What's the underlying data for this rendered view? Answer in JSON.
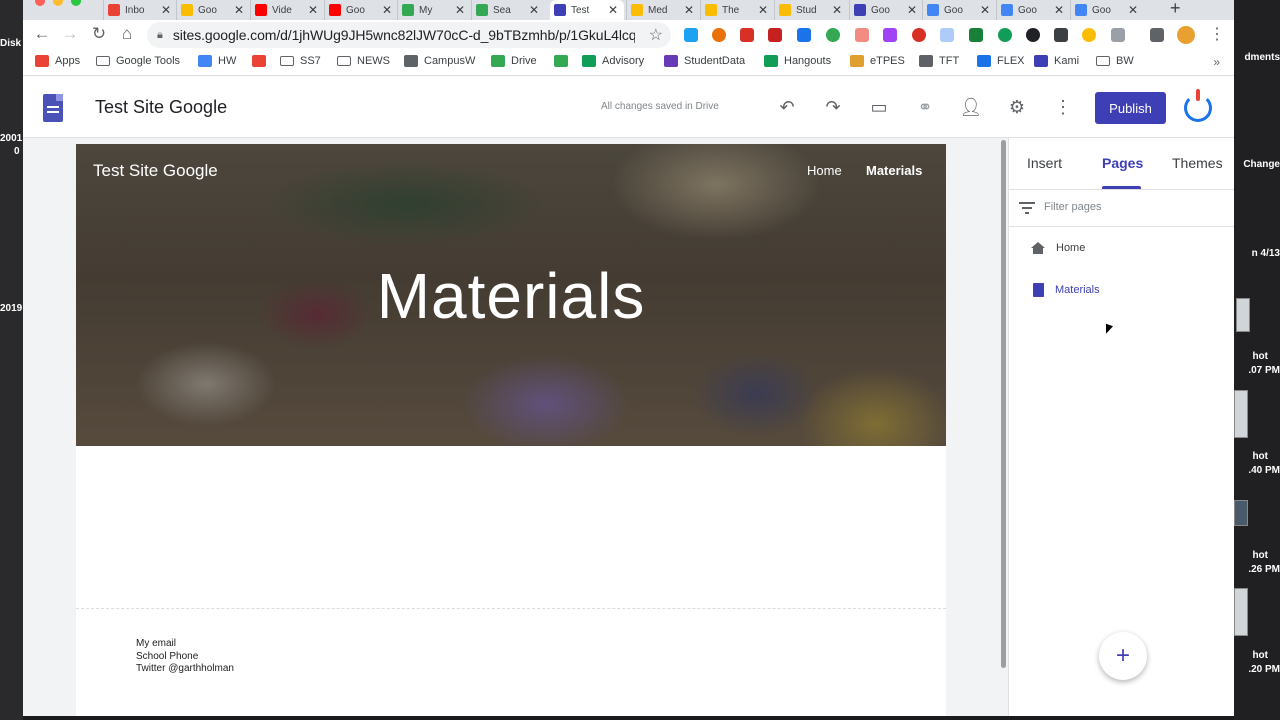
{
  "desktop": {
    "left_labels": [
      "Disk",
      "2001",
      "0",
      "2019"
    ],
    "right_labels": [
      "dments",
      "Change",
      "n 4/13",
      "hot",
      ".07 PM",
      "hot",
      ".40 PM",
      "hot",
      ".26 PM",
      "hot",
      ".20 PM"
    ]
  },
  "browser": {
    "tabs": [
      {
        "title": "Inbo",
        "color": "#ea4335"
      },
      {
        "title": "Goo",
        "color": "#fbbc04"
      },
      {
        "title": "Vide",
        "color": "#ff0000"
      },
      {
        "title": "Goo",
        "color": "#ff0000"
      },
      {
        "title": "My",
        "color": "#34a853"
      },
      {
        "title": "Sea",
        "color": "#34a853"
      },
      {
        "title": "Test",
        "color": "#3f3fb5"
      },
      {
        "title": "Med",
        "color": "#fbbc04"
      },
      {
        "title": "The",
        "color": "#fbbc04"
      },
      {
        "title": "Stud",
        "color": "#fbbc04"
      },
      {
        "title": "Goo",
        "color": "#3f3fb5"
      },
      {
        "title": "Goo",
        "color": "#4285f4"
      },
      {
        "title": "Goo",
        "color": "#4285f4"
      },
      {
        "title": "Goo",
        "color": "#4285f4"
      }
    ],
    "url": "sites.google.com/d/1jhWUg9JH5wnc82lJW70cC-d_9bTBzmhb/p/1GkuL4lcq...",
    "bookmarks": [
      {
        "label": "Apps",
        "icon": "apps-grid-icon",
        "color": "#ea4335"
      },
      {
        "label": "Google Tools",
        "icon": "folder-icon",
        "color": ""
      },
      {
        "label": "HW",
        "icon": "calendar-icon",
        "color": "#4285f4"
      },
      {
        "label": "",
        "icon": "gmail-icon",
        "color": "#ea4335"
      },
      {
        "label": "SS7",
        "icon": "folder-icon",
        "color": ""
      },
      {
        "label": "NEWS",
        "icon": "folder-icon",
        "color": ""
      },
      {
        "label": "CampusW",
        "icon": "w-icon",
        "color": "#5f6368"
      },
      {
        "label": "Drive",
        "icon": "drive-icon",
        "color": "#34a853"
      },
      {
        "label": "",
        "icon": "classroom-icon",
        "color": "#34a853"
      },
      {
        "label": "Advisory",
        "icon": "sheets-icon",
        "color": "#0f9d58"
      },
      {
        "label": "StudentData",
        "icon": "forms-icon",
        "color": "#673ab7"
      },
      {
        "label": "Hangouts",
        "icon": "hangouts-icon",
        "color": "#0f9d58"
      },
      {
        "label": "eTPES",
        "icon": "etpes-icon",
        "color": "#e0a030"
      },
      {
        "label": "TFT",
        "icon": "w-icon",
        "color": "#5f6368"
      },
      {
        "label": "FLEX",
        "icon": "flex-icon",
        "color": "#1a73e8"
      },
      {
        "label": "Kami",
        "icon": "kami-icon",
        "color": "#3f3fb5"
      },
      {
        "label": "BW",
        "icon": "folder-icon",
        "color": ""
      }
    ]
  },
  "editor": {
    "site_name": "Test Site Google",
    "save_status": "All changes saved in Drive",
    "publish_label": "Publish",
    "accent": "#3f3fb5"
  },
  "page": {
    "header_site_title": "Test Site Google",
    "nav": [
      "Home",
      "Materials"
    ],
    "hero_heading": "Materials",
    "footer": [
      "My email",
      "School Phone",
      "Twitter @garthholman"
    ]
  },
  "panel": {
    "tabs": [
      "Insert",
      "Pages",
      "Themes"
    ],
    "active_tab": "Pages",
    "filter_placeholder": "Filter pages",
    "pages": [
      {
        "label": "Home",
        "icon": "home-icon"
      },
      {
        "label": "Materials",
        "icon": "page-icon"
      }
    ],
    "fab_symbol": "+"
  }
}
